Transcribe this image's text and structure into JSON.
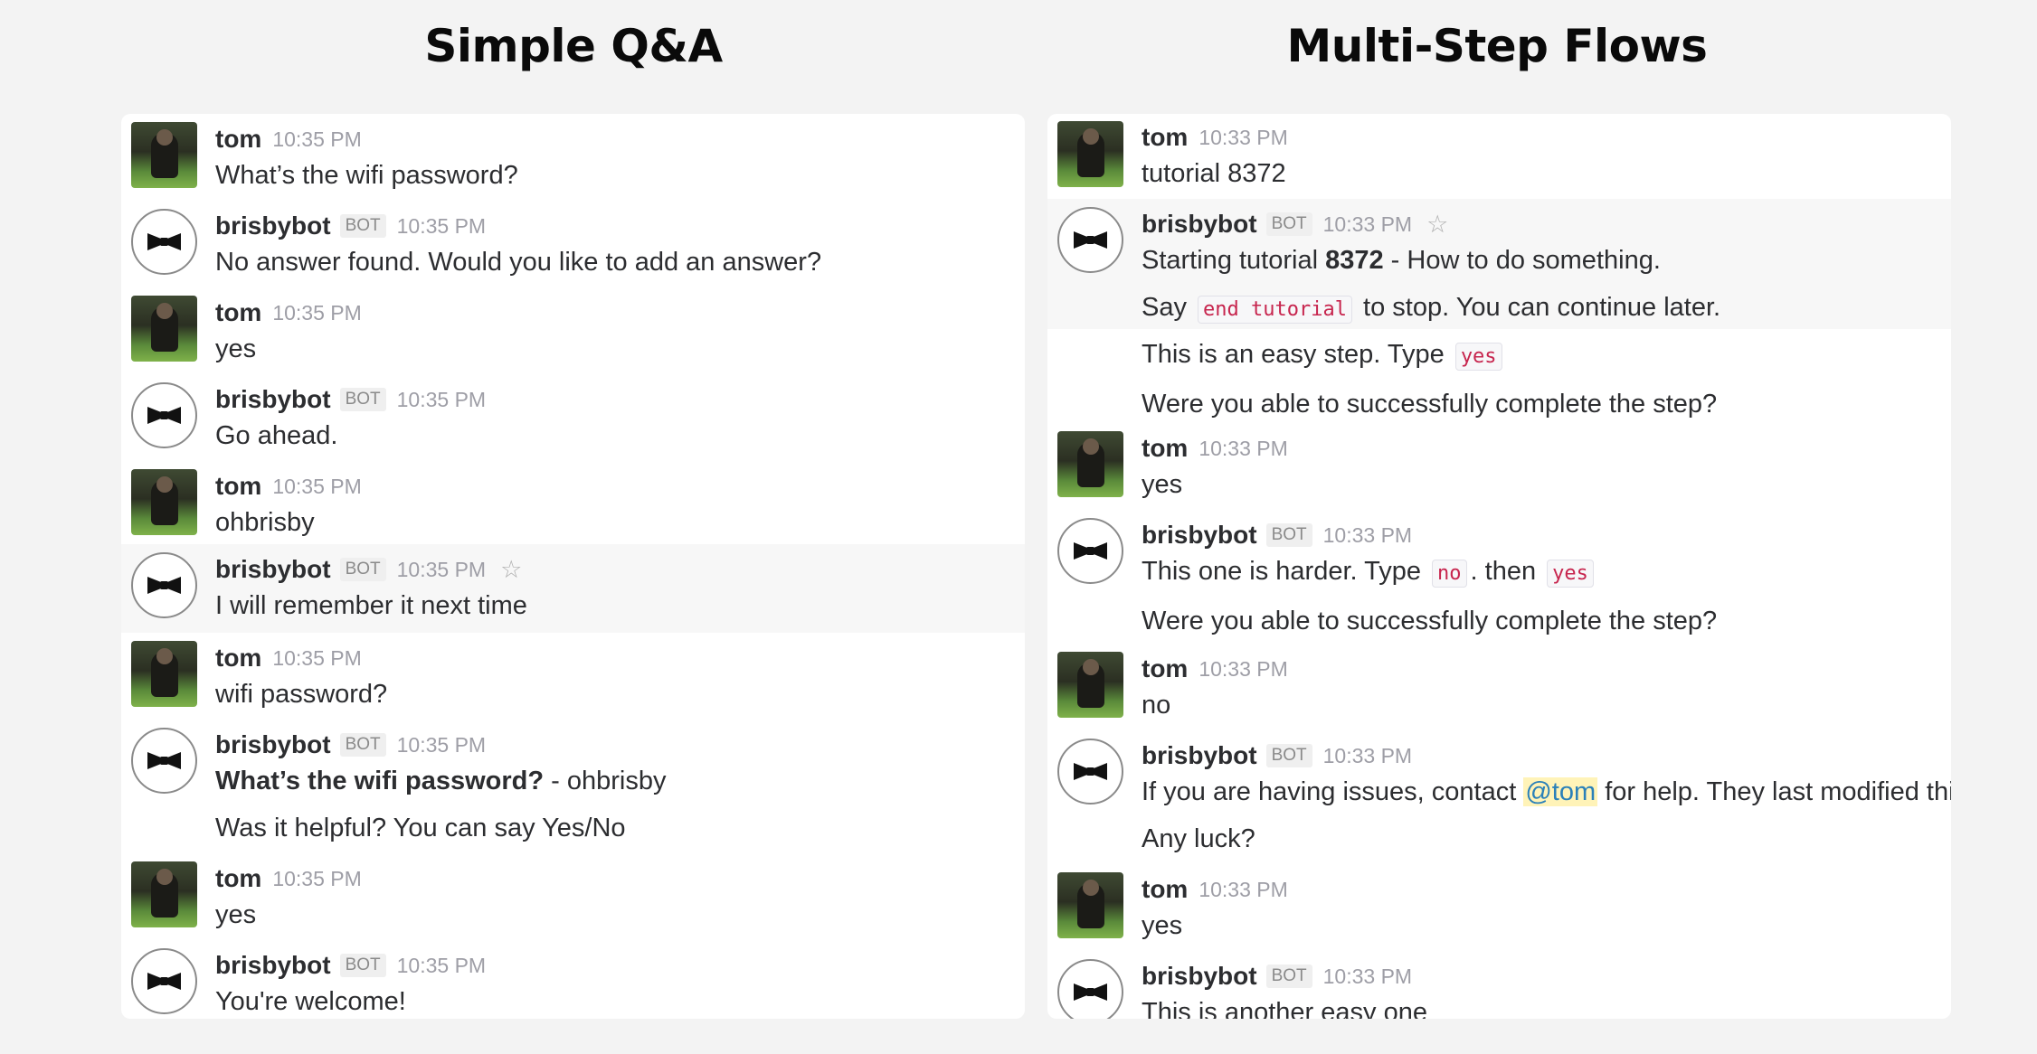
{
  "headings": {
    "left": "Simple Q&A",
    "right": "Multi-Step Flows"
  },
  "icons": {
    "user_avatar": "user-photo-avatar",
    "bot_avatar": "bowtie-icon",
    "star": "star-icon"
  },
  "left": {
    "m1": {
      "name": "tom",
      "time": "10:35 PM",
      "text": "What’s the wifi password?"
    },
    "m2": {
      "name": "brisbybot",
      "badge": "BOT",
      "time": "10:35 PM",
      "text": "No answer found. Would you like to add an answer?"
    },
    "m3": {
      "name": "tom",
      "time": "10:35 PM",
      "text": "yes"
    },
    "m4": {
      "name": "brisbybot",
      "badge": "BOT",
      "time": "10:35 PM",
      "text": "Go ahead."
    },
    "m5": {
      "name": "tom",
      "time": "10:35 PM",
      "text": "ohbrisby"
    },
    "m6": {
      "name": "brisbybot",
      "badge": "BOT",
      "time": "10:35 PM",
      "star": "☆",
      "text": "I will remember it next time"
    },
    "m7": {
      "name": "tom",
      "time": "10:35 PM",
      "text": "wifi password?"
    },
    "m8": {
      "name": "brisbybot",
      "badge": "BOT",
      "time": "10:35 PM",
      "bold": "What’s the wifi password?",
      "rest": " - ohbrisby",
      "text2": "Was it helpful? You can say Yes/No"
    },
    "m9": {
      "name": "tom",
      "time": "10:35 PM",
      "text": "yes"
    },
    "m10": {
      "name": "brisbybot",
      "badge": "BOT",
      "time": "10:35 PM",
      "text": "You're welcome!"
    }
  },
  "right": {
    "m1": {
      "name": "tom",
      "time": "10:33 PM",
      "text": "tutorial 8372"
    },
    "m2": {
      "name": "brisbybot",
      "badge": "BOT",
      "time": "10:33 PM",
      "star": "☆",
      "a": "Starting tutorial ",
      "bold": "8372",
      "b": " - How to do something.",
      "say": "Say ",
      "code": "end tutorial",
      "after": " to stop. You can continue later."
    },
    "m2b": {
      "pre": "This is an easy step. Type ",
      "code": "yes",
      "text2": "Were you able to successfully complete the step?"
    },
    "m3": {
      "name": "tom",
      "time": "10:33 PM",
      "text": "yes"
    },
    "m4": {
      "name": "brisbybot",
      "badge": "BOT",
      "time": "10:33 PM",
      "pre": "This one is harder. Type ",
      "code1": "no",
      "mid": ". then ",
      "code2": "yes",
      "text2": "Were you able to successfully complete the step?"
    },
    "m5": {
      "name": "tom",
      "time": "10:33 PM",
      "text": "no"
    },
    "m6": {
      "name": "brisbybot",
      "badge": "BOT",
      "time": "10:33 PM",
      "pre": "If you are having issues, contact ",
      "mention": "@tom",
      "post": " for help. They last modified thi",
      "text2": "Any luck?"
    },
    "m7": {
      "name": "tom",
      "time": "10:33 PM",
      "text": "yes"
    },
    "m8": {
      "name": "brisbybot",
      "badge": "BOT",
      "time": "10:33 PM",
      "text": "This is another easy one"
    }
  }
}
